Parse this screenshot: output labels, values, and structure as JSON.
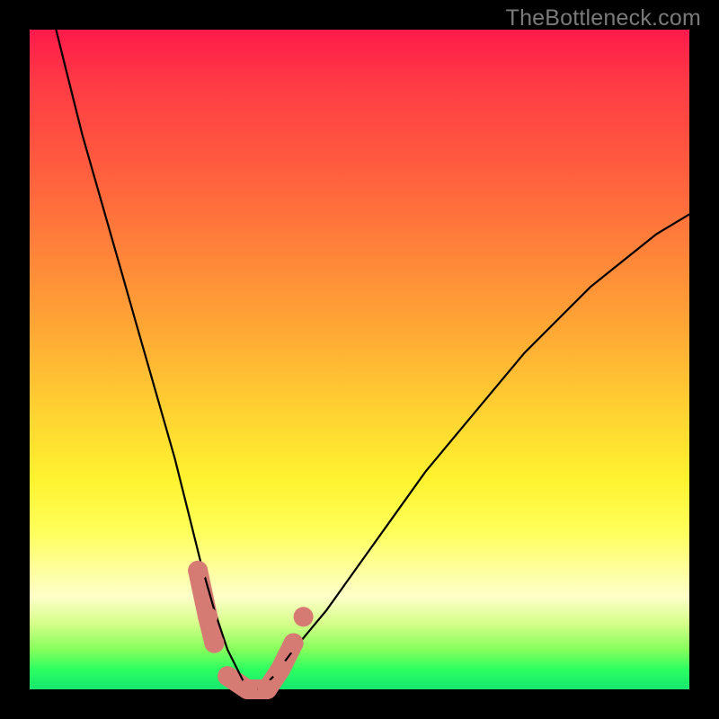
{
  "watermark": "TheBottleneck.com",
  "chart_data": {
    "type": "line",
    "title": "",
    "xlabel": "",
    "ylabel": "",
    "xlim": [
      0,
      100
    ],
    "ylim": [
      0,
      100
    ],
    "grid": false,
    "legend": false,
    "background_gradient": {
      "direction": "top-to-bottom",
      "stops": [
        {
          "pos": 0,
          "color": "#ff1a4b"
        },
        {
          "pos": 0.33,
          "color": "#ff813a"
        },
        {
          "pos": 0.68,
          "color": "#fff22f"
        },
        {
          "pos": 0.86,
          "color": "#fdffc8"
        },
        {
          "pos": 1.0,
          "color": "#16e66f"
        }
      ]
    },
    "series": [
      {
        "name": "bottleneck-curve",
        "color": "#000000",
        "x": [
          4,
          6,
          8,
          10,
          12,
          14,
          16,
          18,
          20,
          22,
          24,
          25,
          26,
          28,
          30,
          32,
          33,
          34,
          35,
          37,
          40,
          45,
          50,
          55,
          60,
          65,
          70,
          75,
          80,
          85,
          90,
          95,
          100
        ],
        "y": [
          100,
          92,
          84,
          77,
          70,
          63,
          56,
          49,
          42,
          35,
          27,
          23,
          19,
          12,
          6,
          2,
          0,
          0,
          0,
          2,
          6,
          12,
          19,
          26,
          33,
          39,
          45,
          51,
          56,
          61,
          65,
          69,
          72
        ]
      }
    ],
    "markers": {
      "name": "datapoints",
      "color": "#d67a74",
      "radius_px": 11,
      "points": [
        {
          "x": 25.5,
          "y": 18
        },
        {
          "x": 27,
          "y": 11
        },
        {
          "x": 28,
          "y": 7
        },
        {
          "x": 30,
          "y": 2
        },
        {
          "x": 33,
          "y": 0
        },
        {
          "x": 36,
          "y": 0
        },
        {
          "x": 38,
          "y": 3
        },
        {
          "x": 40,
          "y": 7
        },
        {
          "x": 41.5,
          "y": 11
        }
      ],
      "linked_segments": [
        [
          0,
          1
        ],
        [
          1,
          2
        ],
        [
          3,
          4
        ],
        [
          4,
          5
        ],
        [
          5,
          6
        ],
        [
          6,
          7
        ]
      ]
    }
  }
}
